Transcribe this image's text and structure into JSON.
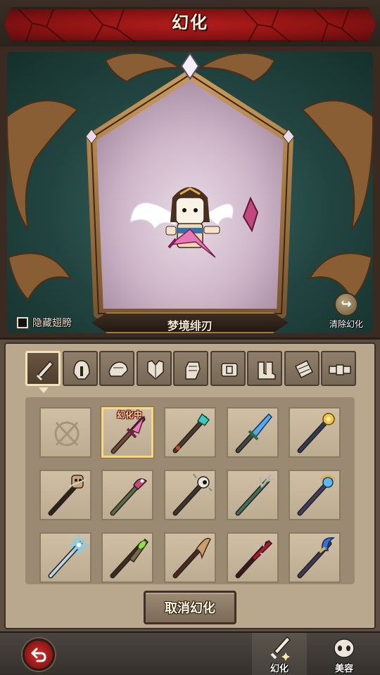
{
  "header": {
    "title": "幻化"
  },
  "preview": {
    "hide_wings_label": "隐藏翅膀",
    "hide_wings_checked": false,
    "skin_name": "梦境绯刃",
    "clear_label": "清除幻化"
  },
  "categories": [
    {
      "name": "weapon",
      "icon": "sword-icon",
      "active": true
    },
    {
      "name": "helmet",
      "icon": "helmet-icon",
      "active": false
    },
    {
      "name": "shoulder",
      "icon": "pauldron-icon",
      "active": false
    },
    {
      "name": "armor",
      "icon": "chest-armor-icon",
      "active": false
    },
    {
      "name": "gloves",
      "icon": "gauntlet-icon",
      "active": false
    },
    {
      "name": "belt",
      "icon": "belt-icon",
      "active": false
    },
    {
      "name": "boots",
      "icon": "boots-icon",
      "active": false
    },
    {
      "name": "bracer",
      "icon": "bracer-icon",
      "active": false
    },
    {
      "name": "accessory",
      "icon": "accessory-icon",
      "active": false
    }
  ],
  "items": [
    {
      "icon": "none-icon",
      "equipped": false
    },
    {
      "icon": "pink-crystal-dagger-icon",
      "equipped": true,
      "tag": "幻化中"
    },
    {
      "icon": "teal-gem-wand-icon",
      "equipped": false
    },
    {
      "icon": "blue-crystal-sword-icon",
      "equipped": false
    },
    {
      "icon": "golden-orb-scepter-icon",
      "equipped": false
    },
    {
      "icon": "voodoo-doll-staff-icon",
      "equipped": false
    },
    {
      "icon": "serpent-staff-icon",
      "equipped": false
    },
    {
      "icon": "eyeball-staff-icon",
      "equipped": false
    },
    {
      "icon": "antler-wand-icon",
      "equipped": false
    },
    {
      "icon": "blue-orb-rod-icon",
      "equipped": false
    },
    {
      "icon": "snowflake-wand-icon",
      "equipped": false
    },
    {
      "icon": "green-gem-blade-icon",
      "equipped": false
    },
    {
      "icon": "scythe-blade-icon",
      "equipped": false
    },
    {
      "icon": "crimson-thorn-sword-icon",
      "equipped": false
    },
    {
      "icon": "blue-crescent-staff-icon",
      "equipped": false
    }
  ],
  "cancel_label": "取消幻化",
  "bottom_nav": [
    {
      "label": "幻化",
      "icon": "transmog-sword-icon",
      "active": true
    },
    {
      "label": "美容",
      "icon": "face-icon",
      "active": false
    }
  ],
  "colors": {
    "title_red": "#9e1818",
    "panel_bg": "#b9a88e",
    "selected_border": "#f4d98a",
    "back_button_red": "#c02420"
  }
}
